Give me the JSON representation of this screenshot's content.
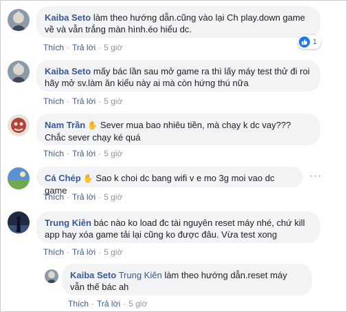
{
  "comments": [
    {
      "author": "Kaiba Seto",
      "text": "làm theo hướng dẫn.cũng vào lại Ch play.down game về và vẫn trắng màn hình.éo hiểu dc.",
      "like": "Thích",
      "reply": "Trả lời",
      "time": "5 giờ",
      "reaction_count": "1"
    },
    {
      "author": "Kaiba Seto",
      "text": "mấy bác lần sau mở game ra thì lấy máy test thử đi roi hãy mở sv.làm ăn kiểu này ai mà còn hứng thú nữa",
      "like": "Thích",
      "reply": "Trả lời",
      "time": "5 giờ"
    },
    {
      "author": "Nam Trần",
      "text": "Sever mua bao nhiêu tiền, mà chạy k dc vay??? Chắc sever chạy ké quá",
      "like": "Thích",
      "reply": "Trả lời",
      "time": "5 giờ"
    },
    {
      "author": "Cá Chép",
      "text": "Sao k choi dc bang wifi v e mo 3g moi vao dc game",
      "like": "Thích",
      "reply": "Trả lời",
      "time": "5 giờ"
    },
    {
      "author": "Trung Kiên",
      "text": "bác nào ko load đc tài nguyên reset máy nhé, chứ kill app hay xóa game tải lại cũng ko được đâu. Vừa test xong",
      "like": "Thích",
      "reply": "Trả lời",
      "time": "5 giờ"
    }
  ],
  "reply": {
    "author": "Kaiba Seto",
    "mention": "Trung Kiên",
    "text": "làm theo hướng dẫn.reset máy vẫn thế bác ah",
    "like": "Thích",
    "reply": "Trả lời",
    "time": "5 giờ"
  },
  "icons": {
    "wave": "hand-wave-icon",
    "like": "like-thumb-icon",
    "more": "more-options-icon"
  },
  "colors": {
    "link": "#385898",
    "bubble": "#f2f3f5",
    "meta": "#90949c",
    "like_blue": "#1877f2"
  }
}
